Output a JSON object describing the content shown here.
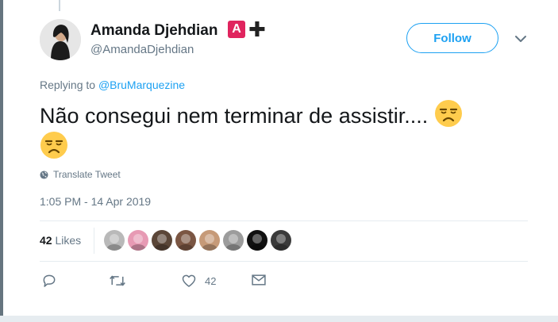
{
  "tweet": {
    "author_name": "Amanda Djehdian",
    "author_handle": "@AmandaDjehdian",
    "badge_letter": "A",
    "badge_plus": "✚",
    "follow_label": "Follow",
    "replying_prefix": "Replying to",
    "replying_to": "@BruMarquezine",
    "text": "Não consegui nem terminar de assistir.... ",
    "translate_label": "Translate Tweet",
    "timestamp": "1:05 PM - 14 Apr 2019",
    "likes_count": "42",
    "likes_label": "Likes",
    "like_action_count": "42"
  },
  "icons": {
    "emoji": "unamused-face-emoji",
    "reply": "reply-icon",
    "retweet": "retweet-icon",
    "like": "heart-icon",
    "dm": "envelope-icon",
    "caret": "chevron-down-icon",
    "globe": "globe-icon"
  },
  "colors": {
    "accent": "#1da1f2",
    "muted": "#657786",
    "text": "#14171a",
    "badge": "#e0245e"
  },
  "liker_avatars": [
    {
      "color": "#b9b9b9"
    },
    {
      "color": "#e79ab4"
    },
    {
      "color": "#5b4638"
    },
    {
      "color": "#7b5643"
    },
    {
      "color": "#c69a78"
    },
    {
      "color": "#9c9c9c"
    },
    {
      "color": "#111111"
    },
    {
      "color": "#3b3b3b"
    }
  ]
}
